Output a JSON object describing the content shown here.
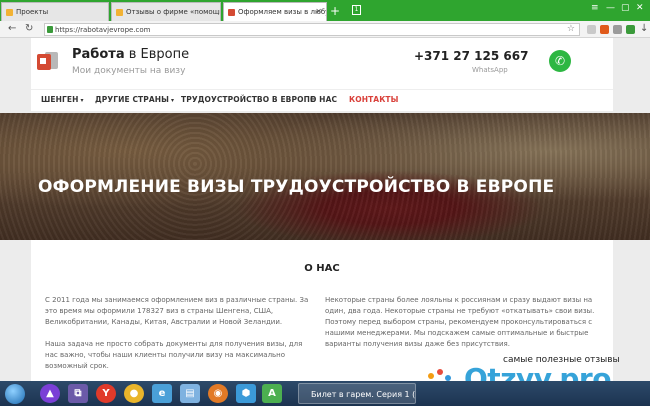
{
  "browser": {
    "tabs": [
      {
        "label": "Проекты",
        "active": false
      },
      {
        "label": "Отзывы о фирме «помощь с и",
        "active": false
      },
      {
        "label": "Оформляем визы в любу",
        "active": true
      }
    ],
    "url": "https://rabotavjevrope.com"
  },
  "site": {
    "brand_bold": "Работа",
    "brand_rest": " в Европе",
    "tagline": "Мои документы на визу",
    "phone": "+371 27 125 667",
    "whatsapp_label": "WhatsApp"
  },
  "nav": {
    "schengen": "ШЕНГЕН",
    "other": "ДРУГИЕ СТРАНЫ",
    "employment": "ТРУДОУСТРОЙСТВО В ЕВРОПЕ",
    "about": "О НАС",
    "contacts": "КОНТАКТЫ"
  },
  "hero": {
    "title": "ОФОРМЛЕНИЕ ВИЗЫ ТРУДОУСТРОЙСТВО В ЕВРОПЕ"
  },
  "about": {
    "title": "О НАС",
    "left_p1": "С 2011 года мы занимаемся оформлением виз в различные страны. За это время мы оформили 178327 виз в страны Шенгена, США, Великобритании, Канады, Китая, Австралии и Новой Зеландии.",
    "left_p2": "Наша задача не просто собрать документы для получения визы, для нас важно, чтобы наши клиенты получили визу на максимально возможный срок.",
    "right_p1": "Некоторые страны более лояльны к россиянам и сразу выдают визы на один, два года. Некоторые страны не требуют «откатывать» свои визы. Поэтому перед выбором страны, рекомендуем проконсультироваться с нашими менеджерами. Мы подскажем самые оптимальные и быстрые варианты получения визы даже без присутствия."
  },
  "watermark": {
    "text": "самые полезные отзывы",
    "brand": "Otzyv.pro"
  },
  "taskbar": {
    "task": "Билет в гарем. Серия 1 (20"
  }
}
